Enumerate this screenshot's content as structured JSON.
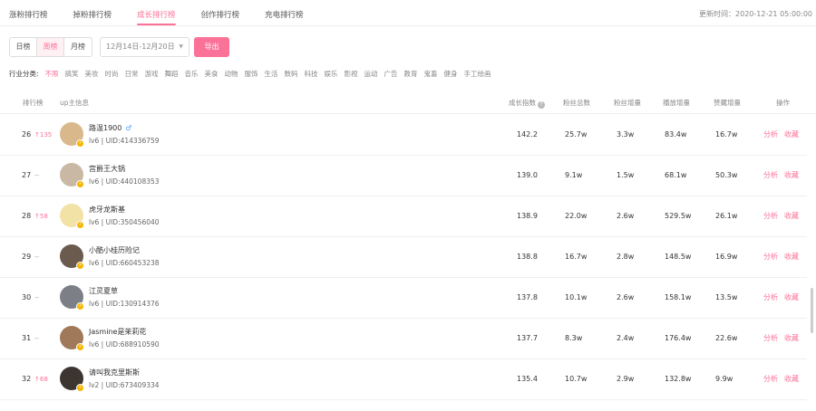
{
  "tabs": [
    {
      "label": "涨粉排行榜",
      "active": false
    },
    {
      "label": "掉粉排行榜",
      "active": false
    },
    {
      "label": "成长排行榜",
      "active": true
    },
    {
      "label": "创作排行榜",
      "active": false
    },
    {
      "label": "充电排行榜",
      "active": false
    }
  ],
  "update_time": "更新时间：2020-12-21 05:00:00",
  "period": [
    {
      "label": "日榜",
      "active": false
    },
    {
      "label": "周榜",
      "active": true
    },
    {
      "label": "月榜",
      "active": false
    }
  ],
  "date_range": "12月14日-12月20日",
  "export_label": "导出",
  "industry": {
    "label": "行业分类:",
    "categories": [
      "不限",
      "搞笑",
      "美妆",
      "时尚",
      "日常",
      "游戏",
      "舞蹈",
      "音乐",
      "美食",
      "动物",
      "服饰",
      "生活",
      "数码",
      "科技",
      "娱乐",
      "影视",
      "运动",
      "广告",
      "教育",
      "鬼畜",
      "健身",
      "手工绘画"
    ],
    "active_index": 0
  },
  "columns": {
    "rank": "排行榜",
    "up_info": "up主信息",
    "growth": "成长指数",
    "fans_total": "粉丝总数",
    "fans_increase": "粉丝增量",
    "play_increase": "播放增量",
    "like_increase": "赞藏增量",
    "operation": "操作"
  },
  "actions": {
    "analyze": "分析",
    "favorite": "收藏"
  },
  "colors": {
    "accent": "#fb7299",
    "gender_male": "#4aa3ff",
    "badge": "#f7b500"
  },
  "rows": [
    {
      "rank": "26",
      "trend": "↑135",
      "trend_dir": "up",
      "name": "路温1900",
      "gender_icon": "male-icon",
      "info": "lv6 | UID:414336759",
      "growth": "142.2",
      "fans_total": "25.7w",
      "fans_increase": "3.3w",
      "play_increase": "83.4w",
      "like_increase": "16.7w",
      "avatar_color": "#d9b88c"
    },
    {
      "rank": "27",
      "trend": "--",
      "trend_dir": "same",
      "name": "宫爵王大锅",
      "gender_icon": "",
      "info": "lv6 | UID:440108353",
      "growth": "139.0",
      "fans_total": "9.1w",
      "fans_increase": "1.5w",
      "play_increase": "68.1w",
      "like_increase": "50.3w",
      "avatar_color": "#c9b9a4"
    },
    {
      "rank": "28",
      "trend": "↑58",
      "trend_dir": "up",
      "name": "虎牙龙斯基",
      "gender_icon": "",
      "info": "lv6 | UID:350456040",
      "growth": "138.9",
      "fans_total": "22.0w",
      "fans_increase": "2.6w",
      "play_increase": "529.5w",
      "like_increase": "26.1w",
      "avatar_color": "#f2e2a6"
    },
    {
      "rank": "29",
      "trend": "--",
      "trend_dir": "same",
      "name": "小酷小桂历险记",
      "gender_icon": "",
      "info": "lv6 | UID:660453238",
      "growth": "138.8",
      "fans_total": "16.7w",
      "fans_increase": "2.8w",
      "play_increase": "148.5w",
      "like_increase": "16.9w",
      "avatar_color": "#6b5a4e"
    },
    {
      "rank": "30",
      "trend": "--",
      "trend_dir": "same",
      "name": "江灵夏草",
      "gender_icon": "",
      "info": "lv6 | UID:130914376",
      "growth": "137.8",
      "fans_total": "10.1w",
      "fans_increase": "2.6w",
      "play_increase": "158.1w",
      "like_increase": "13.5w",
      "avatar_color": "#7c7f86"
    },
    {
      "rank": "31",
      "trend": "--",
      "trend_dir": "same",
      "name": "Jasmine是茉莉花",
      "gender_icon": "",
      "info": "lv6 | UID:688910590",
      "growth": "137.7",
      "fans_total": "8.3w",
      "fans_increase": "2.4w",
      "play_increase": "176.4w",
      "like_increase": "22.6w",
      "avatar_color": "#a0785a"
    },
    {
      "rank": "32",
      "trend": "↑68",
      "trend_dir": "up",
      "name": "请叫我克里斯斯",
      "gender_icon": "",
      "info": "lv2 | UID:673409334",
      "growth": "135.4",
      "fans_total": "10.7w",
      "fans_increase": "2.9w",
      "play_increase": "132.8w",
      "like_increase": "9.9w",
      "avatar_color": "#3d3530"
    }
  ]
}
